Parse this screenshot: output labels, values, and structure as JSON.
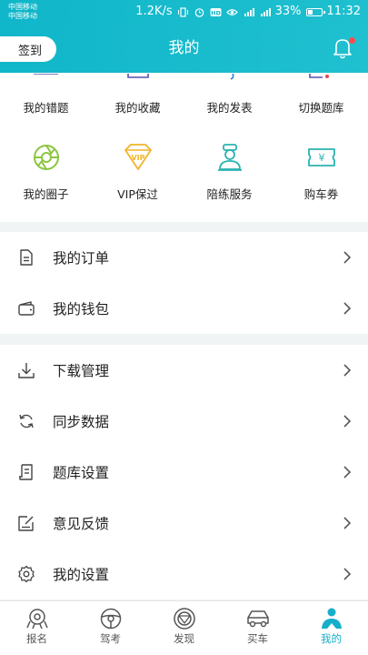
{
  "status_bar": {
    "carrier_1": "中国移动",
    "carrier_2": "中国移动",
    "speed": "1.2K/s",
    "battery": "33%",
    "battery_level": 0.33,
    "time": "11:32"
  },
  "header": {
    "checkin": "签到",
    "title": "我的"
  },
  "grid_row_1": [
    {
      "label": "我的错题"
    },
    {
      "label": "我的收藏"
    },
    {
      "label": "我的发表"
    },
    {
      "label": "切换题库"
    }
  ],
  "grid_row_2": [
    {
      "label": "我的圈子",
      "icon": "aperture-icon"
    },
    {
      "label": "VIP保过",
      "icon": "vip-diamond-icon",
      "badge": "VIP"
    },
    {
      "label": "陪练服务",
      "icon": "coach-icon"
    },
    {
      "label": "购车券",
      "icon": "ticket-icon",
      "symbol": "¥"
    }
  ],
  "list_group_1": [
    {
      "label": "我的订单",
      "icon": "order-document-icon"
    },
    {
      "label": "我的钱包",
      "icon": "wallet-icon"
    }
  ],
  "list_group_2": [
    {
      "label": "下载管理",
      "icon": "download-icon"
    },
    {
      "label": "同步数据",
      "icon": "sync-icon"
    },
    {
      "label": "题库设置",
      "icon": "question-bank-icon"
    },
    {
      "label": "意见反馈",
      "icon": "feedback-icon"
    },
    {
      "label": "我的设置",
      "icon": "settings-gear-icon"
    }
  ],
  "tabs": [
    {
      "label": "报名",
      "icon": "signup-icon"
    },
    {
      "label": "驾考",
      "icon": "steering-wheel-icon"
    },
    {
      "label": "发现",
      "icon": "discover-icon"
    },
    {
      "label": "买车",
      "icon": "car-icon"
    },
    {
      "label": "我的",
      "icon": "profile-icon",
      "active": true
    }
  ],
  "colors": {
    "brand": "#16b8ca",
    "notification_dot": "#ff4b4b",
    "aperture_green": "#8cc63f",
    "vip_gold": "#f0b429",
    "coach_teal": "#2ab3b0",
    "ticket_teal": "#2ab3b0"
  }
}
